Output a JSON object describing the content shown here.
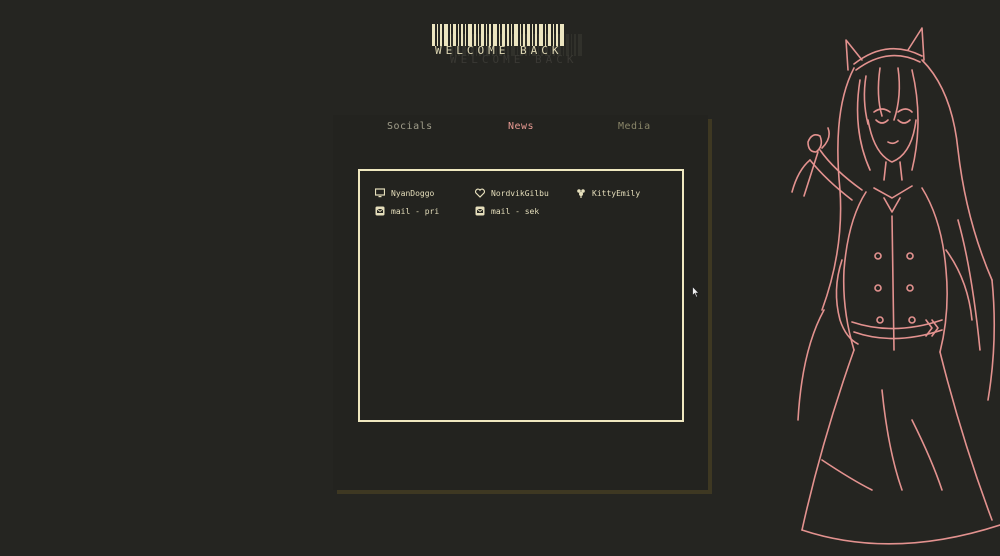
{
  "header": {
    "title": "WELCOME BACK",
    "title_shadow": "WELCOME BACK"
  },
  "tabs": [
    {
      "label": "Socials"
    },
    {
      "label": "News"
    },
    {
      "label": "Media"
    }
  ],
  "links": [
    {
      "label": "NyanDoggo",
      "icon": "monitor-icon"
    },
    {
      "label": "NordvikGilbu",
      "icon": "heart-icon"
    },
    {
      "label": "KittyEmily",
      "icon": "flower-icon"
    },
    {
      "label": "mail - pri",
      "icon": "mail-icon"
    },
    {
      "label": "mail - sek",
      "icon": "mail-icon"
    }
  ],
  "colors": {
    "background": "#252521",
    "text": "#e8e3c2",
    "accent_news": "#e89a92",
    "panel_shadow": "#3e3822",
    "art_line": "#e3928f"
  }
}
